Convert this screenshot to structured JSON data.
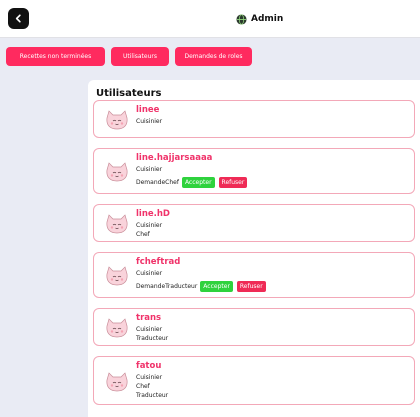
{
  "header": {
    "title": "Admin",
    "back_icon": "chevron-left-icon",
    "title_icon": "globe-icon"
  },
  "nav": {
    "items": [
      "Recettes non terminées",
      "Utilisateurs",
      "Demandes de roles"
    ],
    "button_color": "#ff2a5f"
  },
  "users_panel": {
    "title": "Utilisateurs",
    "accept_label": "Accepter",
    "refuse_label": "Refuser",
    "users": [
      {
        "username": "linee",
        "roles": [
          "Cuisinier"
        ]
      },
      {
        "username": "line.hajjarsaaaa",
        "roles": [
          "Cuisinier"
        ],
        "request": "DemandeChef"
      },
      {
        "username": "line.hD",
        "roles": [
          "Cuisinier",
          "Chef"
        ]
      },
      {
        "username": "fcheftrad",
        "roles": [
          "Cuisinier"
        ],
        "request": "DemandeTraducteur"
      },
      {
        "username": "trans",
        "roles": [
          "Cuisinier",
          "Traducteur"
        ]
      },
      {
        "username": "fatou",
        "roles": [
          "Cuisinier",
          "Chef",
          "Traducteur"
        ]
      }
    ]
  },
  "colors": {
    "accent": "#ff2a5f",
    "accept": "#2fd23d",
    "refuse": "#ef2b56",
    "username": "#f0336a",
    "card_border": "#f3a8b8"
  }
}
